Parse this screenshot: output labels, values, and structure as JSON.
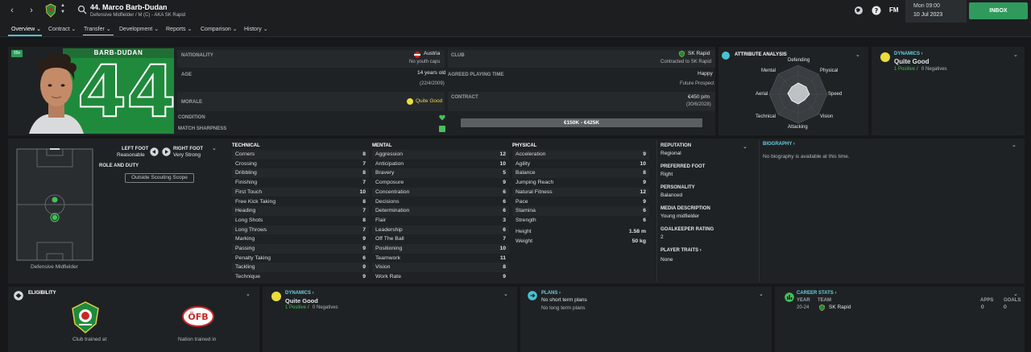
{
  "header": {
    "title": "44. Marco Barb-Dudan",
    "subtitle": "Defensive Midfielder / M (C) - AKA SK Rapid",
    "fm_logo": "FM",
    "date_time": "Mon 09:00",
    "date_day": "10 Jul 2023",
    "inbox_label": "INBOX"
  },
  "tabs": [
    {
      "label": "Overview ⌄"
    },
    {
      "label": "Contract ⌄"
    },
    {
      "label": "Transfer ⌄"
    },
    {
      "label": "Development ⌄"
    },
    {
      "label": "Reports ⌄"
    },
    {
      "label": "Comparison ⌄"
    },
    {
      "label": "History ⌄"
    }
  ],
  "profile": {
    "ca_badge": "99s",
    "name_banner": "BARB-DUDAN",
    "number": "44",
    "nationality_label": "NATIONALITY",
    "nationality": "Austria",
    "youth_caps": "No youth caps",
    "age_label": "AGE",
    "age": "14 years old",
    "dob": "(22/4/2009)",
    "morale_label": "MORALE",
    "morale": "Quite Good",
    "condition_label": "CONDITION",
    "sharpness_label": "MATCH SHARPNESS",
    "club_label": "CLUB",
    "club": "SK Rapid",
    "contracted": "Contracted to SK Rapid",
    "playing_time_label": "AGREED PLAYING TIME",
    "playing_time_status": "Happy",
    "playing_time": "Future Prospect",
    "contract_label": "CONTRACT",
    "wage": "€450 p/m",
    "contract_end": "(30/6/2028)",
    "value_range": "€150K - €425K"
  },
  "attribute_analysis": {
    "title": "ATTRIBUTE ANALYSIS",
    "labels": {
      "defending": "Defending",
      "physical": "Physical",
      "speed": "Speed",
      "vision": "Vision",
      "attacking": "Attacking",
      "technical": "Technical",
      "aerial": "Aerial",
      "mental": "Mental"
    }
  },
  "dynamics_top": {
    "title": "DYNAMICS ›",
    "status": "Quite Good",
    "positive": "1 Positive",
    "separator": "/",
    "negatives": "0 Negatives"
  },
  "feet": {
    "left_label": "LEFT FOOT",
    "left_value": "Reasonable",
    "right_label": "RIGHT FOOT",
    "right_value": "Very Strong"
  },
  "role": {
    "label": "ROLE AND DUTY",
    "scope_button": "Outside Scouting Scope",
    "position": "Defensive Midfielder"
  },
  "technical": {
    "title": "TECHNICAL",
    "items": [
      {
        "name": "Corners",
        "value": "8"
      },
      {
        "name": "Crossing",
        "value": "7"
      },
      {
        "name": "Dribbling",
        "value": "8"
      },
      {
        "name": "Finishing",
        "value": "7"
      },
      {
        "name": "First Touch",
        "value": "10"
      },
      {
        "name": "Free Kick Taking",
        "value": "8"
      },
      {
        "name": "Heading",
        "value": "7"
      },
      {
        "name": "Long Shots",
        "value": "8"
      },
      {
        "name": "Long Throws",
        "value": "7"
      },
      {
        "name": "Marking",
        "value": "9"
      },
      {
        "name": "Passing",
        "value": "9"
      },
      {
        "name": "Penalty Taking",
        "value": "6"
      },
      {
        "name": "Tackling",
        "value": "9"
      },
      {
        "name": "Technique",
        "value": "9"
      }
    ]
  },
  "mental": {
    "title": "MENTAL",
    "items": [
      {
        "name": "Aggression",
        "value": "12",
        "hl": true
      },
      {
        "name": "Anticipation",
        "value": "10"
      },
      {
        "name": "Bravery",
        "value": "5"
      },
      {
        "name": "Composure",
        "value": "9"
      },
      {
        "name": "Concentration",
        "value": "6"
      },
      {
        "name": "Decisions",
        "value": "6"
      },
      {
        "name": "Determination",
        "value": "6"
      },
      {
        "name": "Flair",
        "value": "3"
      },
      {
        "name": "Leadership",
        "value": "6"
      },
      {
        "name": "Off The Ball",
        "value": "7"
      },
      {
        "name": "Positioning",
        "value": "10"
      },
      {
        "name": "Teamwork",
        "value": "11",
        "hl": true
      },
      {
        "name": "Vision",
        "value": "8"
      },
      {
        "name": "Work Rate",
        "value": "9"
      }
    ]
  },
  "physical": {
    "title": "PHYSICAL",
    "items": [
      {
        "name": "Acceleration",
        "value": "9"
      },
      {
        "name": "Agility",
        "value": "10"
      },
      {
        "name": "Balance",
        "value": "8"
      },
      {
        "name": "Jumping Reach",
        "value": "9"
      },
      {
        "name": "Natural Fitness",
        "value": "12",
        "hl": true
      },
      {
        "name": "Pace",
        "value": "9"
      },
      {
        "name": "Stamina",
        "value": "6"
      },
      {
        "name": "Strength",
        "value": "6"
      }
    ],
    "height_label": "Height",
    "height": "1.58 m",
    "weight_label": "Weight",
    "weight": "50 kg"
  },
  "info": {
    "reputation_label": "REPUTATION",
    "reputation": "Regional",
    "foot_label": "PREFERRED FOOT",
    "foot": "Right",
    "personality_label": "PERSONALITY",
    "personality": "Balanced",
    "media_label": "MEDIA DESCRIPTION",
    "media": "Young midfielder",
    "gk_label": "GOALKEEPER RATING",
    "gk": "2",
    "traits_label": "PLAYER TRAITS ›",
    "traits": "None"
  },
  "biography": {
    "title": "BIOGRAPHY ›",
    "text": "No biography is available at this time."
  },
  "eligibility": {
    "title": "ELIGIBILITY",
    "club_caption": "Club trained at",
    "nation_caption": "Nation trained in",
    "nation_logo_text": "ÖFB"
  },
  "dynamics_bottom": {
    "title": "DYNAMICS ›",
    "status": "Quite Good",
    "positive": "1 Positive",
    "separator": "/",
    "negatives": "0 Negatives"
  },
  "plans": {
    "title": "PLANS ›",
    "short": "No short term plans",
    "long": "No long term plans"
  },
  "career": {
    "title": "CAREER STATS ›",
    "col_year": "YEAR",
    "col_team": "TEAM",
    "col_apps": "APPS",
    "col_goals": "GOALS",
    "year": "20-24",
    "team": "SK Rapid",
    "apps": "0",
    "goals": "0"
  },
  "colors": {
    "accent": "#48c2d2",
    "jersey_green": "#1f8a3c",
    "positive": "#45c05b",
    "highlight": "#e9de3b",
    "inbox": "#2f9a5c"
  }
}
